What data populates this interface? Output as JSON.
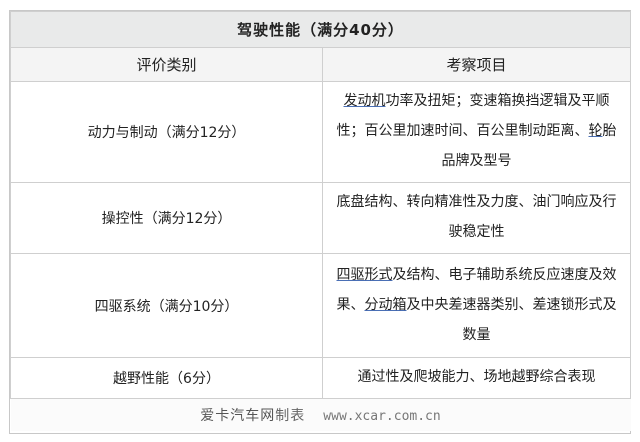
{
  "table": {
    "title": "驾驶性能（满分40分）",
    "headers": {
      "category": "评价类别",
      "items": "考察项目"
    },
    "rows": [
      {
        "category": "动力与制动（满分12分）",
        "parts": [
          {
            "text": "发动机",
            "link": true
          },
          {
            "text": "功率及扭矩；变速箱换挡逻辑及平顺性；百公里加速时间、百公里制动距离、",
            "link": false
          },
          {
            "text": "轮",
            "link": true
          },
          {
            "text": "胎品牌及型号",
            "link": false
          }
        ]
      },
      {
        "category": "操控性（满分12分）",
        "parts": [
          {
            "text": "底盘结构、转向精准性及力度、油门响应及行驶稳定性",
            "link": false
          }
        ]
      },
      {
        "category": "四驱系统（满分10分）",
        "parts": [
          {
            "text": "四驱形式",
            "link": true
          },
          {
            "text": "及结构、电子辅助系统反应速度及效果、",
            "link": false
          },
          {
            "text": "分动箱",
            "link": true
          },
          {
            "text": "及中央差速器类别、差速锁形式及数量",
            "link": false
          }
        ]
      },
      {
        "category": "越野性能（6分）",
        "parts": [
          {
            "text": "通过性及爬坡能力、场地越野综合表现",
            "link": false
          }
        ]
      }
    ]
  },
  "footer": {
    "brand_main": "爱卡汽车网",
    "brand_suffix": "制表",
    "url": "www.xcar.com.cn"
  }
}
